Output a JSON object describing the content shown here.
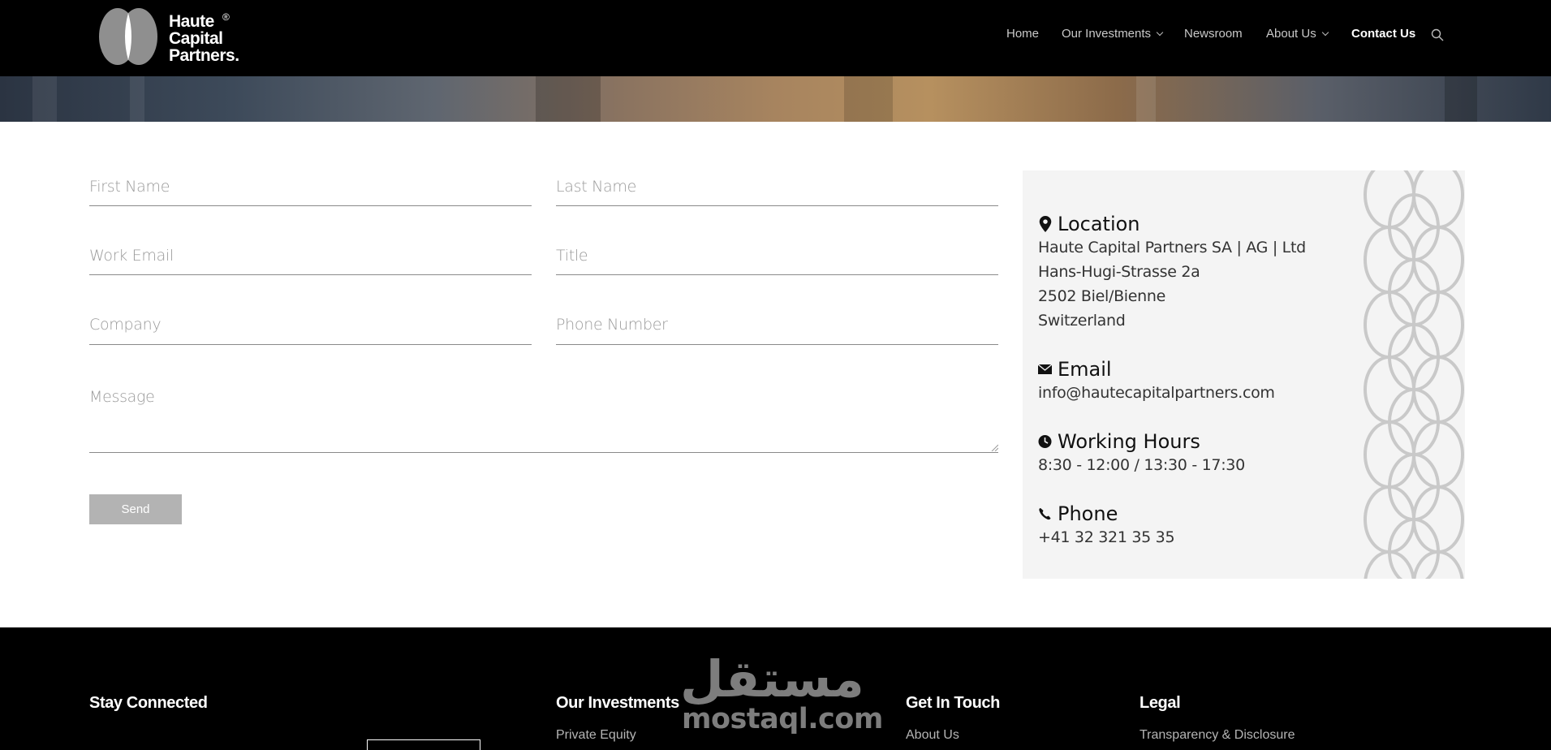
{
  "header": {
    "logo": {
      "line1": "Haute",
      "line2": "Capital",
      "line3": "Partners.",
      "registered": "®"
    },
    "nav": [
      {
        "label": "Home",
        "has_dropdown": false,
        "active": false
      },
      {
        "label": "Our Investments",
        "has_dropdown": true,
        "active": false
      },
      {
        "label": "Newsroom",
        "has_dropdown": false,
        "active": false
      },
      {
        "label": "About Us",
        "has_dropdown": true,
        "active": false
      },
      {
        "label": "Contact Us",
        "has_dropdown": false,
        "active": true
      }
    ],
    "search_icon": "search-icon"
  },
  "form": {
    "first_name": {
      "placeholder": "First Name",
      "value": ""
    },
    "last_name": {
      "placeholder": "Last Name",
      "value": ""
    },
    "work_email": {
      "placeholder": "Work Email",
      "value": ""
    },
    "title": {
      "placeholder": "Title",
      "value": ""
    },
    "company": {
      "placeholder": "Company",
      "value": ""
    },
    "phone": {
      "placeholder": "Phone Number",
      "value": ""
    },
    "message": {
      "placeholder": "Message",
      "value": ""
    },
    "send_label": "Send"
  },
  "contact_card": {
    "location": {
      "heading": "Location",
      "icon": "map-pin-icon",
      "lines": [
        "Haute Capital Partners SA | AG | Ltd",
        "Hans-Hugi-Strasse 2a",
        "2502 Biel/Bienne",
        "Switzerland"
      ]
    },
    "email": {
      "heading": "Email",
      "icon": "envelope-icon",
      "value": "info@hautecapitalpartners.com"
    },
    "hours": {
      "heading": "Working Hours",
      "icon": "clock-icon",
      "value": "8:30 - 12:00 / 13:30 - 17:30"
    },
    "phone": {
      "heading": "Phone",
      "icon": "phone-icon",
      "value": "+41 32 321 35 35"
    }
  },
  "footer": {
    "stay_connected": "Stay Connected",
    "our_investments": {
      "heading": "Our Investments",
      "link": "Private Equity"
    },
    "get_in_touch": {
      "heading": "Get In Touch",
      "link": "About Us"
    },
    "legal": {
      "heading": "Legal",
      "link": "Transparency & Disclosure"
    }
  },
  "watermark": {
    "arabic": "مستقل",
    "latin": "mostaql.com"
  },
  "colors": {
    "header_bg": "#000000",
    "card_bg": "#f4f4f4",
    "send_button": "#b3b3b3"
  }
}
